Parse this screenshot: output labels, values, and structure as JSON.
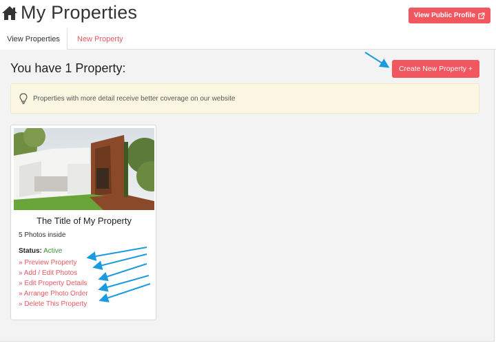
{
  "header": {
    "title": "My Properties",
    "public_profile_button": "View Public Profile"
  },
  "tabs": [
    {
      "label": "View Properties",
      "active": true
    },
    {
      "label": "New Property",
      "active": false
    }
  ],
  "main": {
    "heading": "You have 1 Property:",
    "create_button": "Create New Property +",
    "alert_text": "Properties with more detail receive better coverage on our website"
  },
  "property": {
    "title": "The Title of My Property",
    "photos_text": "5 Photos inside",
    "status_label": "Status:",
    "status_value": "Active",
    "actions": [
      "» Preview Property",
      "» Add / Edit Photos",
      "» Edit Property Details",
      "» Arrange Photo Order",
      "» Delete This Property"
    ]
  },
  "colors": {
    "accent": "#f2575f",
    "link": "#e9585f",
    "status_active": "#3a8f3a",
    "annotation_arrow": "#1b9ae0",
    "alert_bg": "#fcf7e3"
  },
  "icons": [
    "home-icon",
    "external-link-icon",
    "lightbulb-icon"
  ]
}
